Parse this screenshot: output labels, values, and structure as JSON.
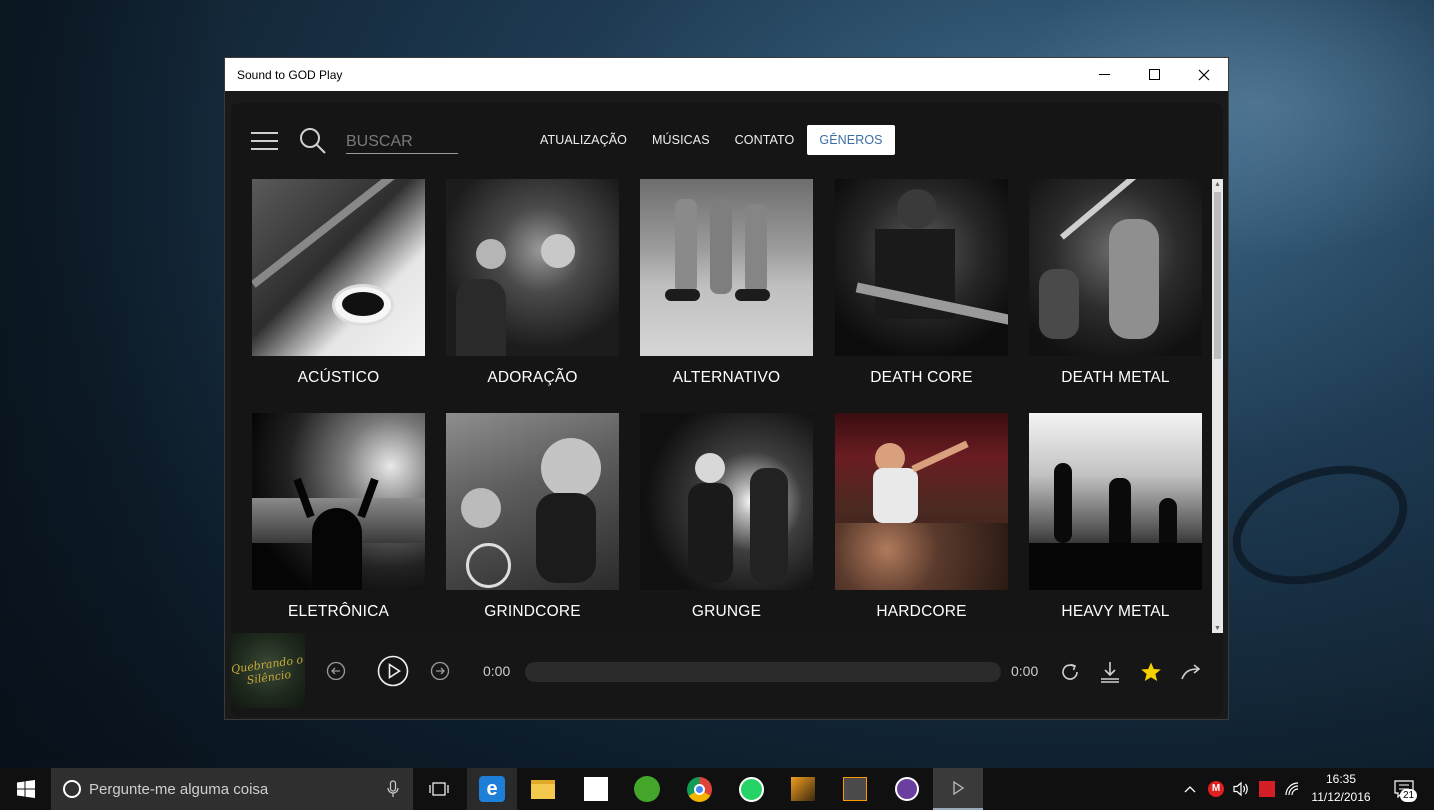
{
  "window": {
    "title": "Sound to GOD  Play"
  },
  "search": {
    "placeholder": "BUSCAR"
  },
  "nav": [
    {
      "label": "ATUALIZAÇÃO",
      "active": false
    },
    {
      "label": "MÚSICAS",
      "active": false
    },
    {
      "label": "CONTATO",
      "active": false
    },
    {
      "label": "GÊNEROS",
      "active": true
    }
  ],
  "genres": [
    {
      "label": "ACÚSTICO"
    },
    {
      "label": "ADORAÇÃO"
    },
    {
      "label": "ALTERNATIVO"
    },
    {
      "label": "DEATH CORE"
    },
    {
      "label": "DEATH METAL"
    },
    {
      "label": "ELETRÔNICA"
    },
    {
      "label": "GRINDCORE"
    },
    {
      "label": "GRUNGE"
    },
    {
      "label": "HARDCORE"
    },
    {
      "label": "HEAVY METAL"
    }
  ],
  "player": {
    "cover_text": "Quebrando o Silêncio",
    "time_current": "0:00",
    "time_total": "0:00",
    "progress": 0
  },
  "taskbar": {
    "search_placeholder": "Pergunte-me alguma coisa",
    "time": "16:35",
    "date": "11/12/2016",
    "notifications": "21"
  },
  "colors": {
    "accent_nav_active_text": "#3b6ea5",
    "star": "#f5d000",
    "app_bg": "#151515"
  }
}
